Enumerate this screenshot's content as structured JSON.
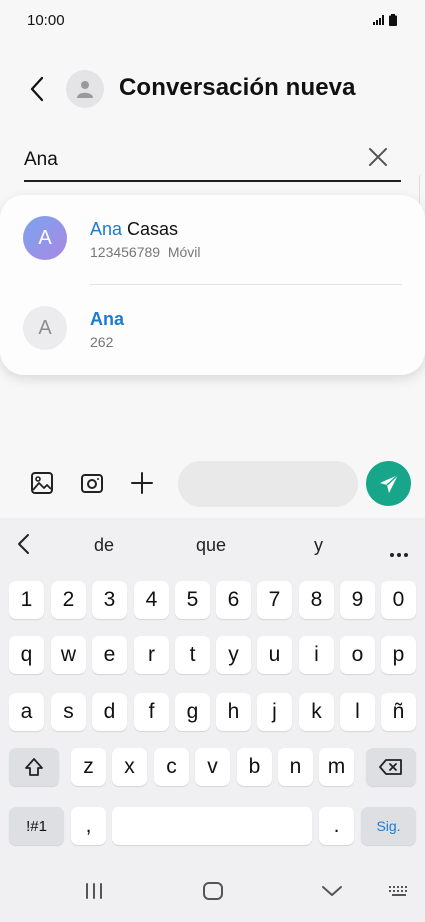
{
  "status": {
    "time": "10:00"
  },
  "header": {
    "title": "Conversación nueva"
  },
  "search": {
    "value": "Ana"
  },
  "suggestions": [
    {
      "name_match": "Ana",
      "name_rest": " Casas",
      "avatar_letter": "A",
      "number": "123456789",
      "type": "Móvil"
    },
    {
      "name_match": "Ana",
      "name_rest": "",
      "avatar_letter": "A",
      "number": "262",
      "type": ""
    }
  ],
  "keyboard": {
    "suggestions": [
      "de",
      "que",
      "y"
    ],
    "row_numbers": [
      "1",
      "2",
      "3",
      "4",
      "5",
      "6",
      "7",
      "8",
      "9",
      "0"
    ],
    "row1": [
      "q",
      "w",
      "e",
      "r",
      "t",
      "y",
      "u",
      "i",
      "o",
      "p"
    ],
    "row2": [
      "a",
      "s",
      "d",
      "f",
      "g",
      "h",
      "j",
      "k",
      "l",
      "ñ"
    ],
    "row3": [
      "z",
      "x",
      "c",
      "v",
      "b",
      "n",
      "m"
    ],
    "symbols_label": "!#1",
    "comma": ",",
    "period": ".",
    "next_label": "Sig."
  },
  "colors": {
    "accent": "#1d7bd0",
    "send": "#17a689"
  },
  "icons": [
    "back-icon",
    "contact-avatar-icon",
    "close-icon",
    "image-icon",
    "camera-icon",
    "plus-icon",
    "send-icon",
    "shift-icon",
    "backspace-icon",
    "more-icon",
    "recents-nav-icon",
    "home-nav-icon",
    "back-nav-icon",
    "keyboard-nav-icon"
  ]
}
